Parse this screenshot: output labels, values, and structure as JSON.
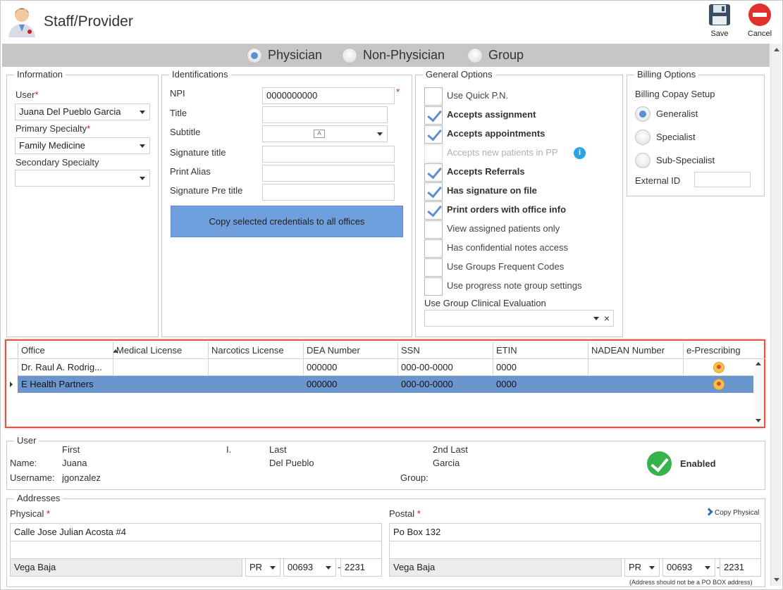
{
  "header": {
    "title": "Staff/Provider",
    "save_label": "Save",
    "cancel_label": "Cancel"
  },
  "provider_types": [
    {
      "label": "Physician",
      "selected": true
    },
    {
      "label": "Non-Physician",
      "selected": false
    },
    {
      "label": "Group",
      "selected": false
    }
  ],
  "information": {
    "legend": "Information",
    "user_label": "User",
    "user_value": "Juana Del Pueblo Garcia",
    "primary_label": "Primary Specialty",
    "primary_value": "Family Medicine",
    "secondary_label": "Secondary Specialty",
    "secondary_value": ""
  },
  "identifications": {
    "legend": "Identifications",
    "npi_label": "NPI",
    "npi_value": "0000000000",
    "title_label": "Title",
    "subtitle_label": "Subtitle",
    "sigtitle_label": "Signature title",
    "alias_label": "Print Alias",
    "sigpre_label": "Signature Pre title",
    "copy_button": "Copy selected credentials to all offices"
  },
  "general_options": {
    "legend": "General Options",
    "items": [
      {
        "label": "Use Quick P.N.",
        "checked": false,
        "bold": false,
        "disabled": false
      },
      {
        "label": "Accepts assignment",
        "checked": true,
        "bold": true,
        "disabled": false
      },
      {
        "label": "Accepts appointments",
        "checked": true,
        "bold": true,
        "disabled": false
      },
      {
        "label": "Accepts new patients in PP",
        "checked": false,
        "bold": false,
        "disabled": true
      },
      {
        "label": "Accepts Referrals",
        "checked": true,
        "bold": true,
        "disabled": false
      },
      {
        "label": "Has signature on file",
        "checked": true,
        "bold": true,
        "disabled": false
      },
      {
        "label": "Print orders with office info",
        "checked": true,
        "bold": true,
        "disabled": false
      },
      {
        "label": "View assigned patients only",
        "checked": false,
        "bold": false,
        "disabled": false
      },
      {
        "label": "Has confidential notes access",
        "checked": false,
        "bold": false,
        "disabled": false
      },
      {
        "label": "Use Groups Frequent Codes",
        "checked": false,
        "bold": false,
        "disabled": false
      },
      {
        "label": "Use progress note group settings",
        "checked": false,
        "bold": false,
        "disabled": false
      }
    ],
    "clinical_eval_label": "Use Group Clinical Evaluation",
    "info_glyph": "i"
  },
  "billing": {
    "legend": "Billing Options",
    "copay_label": "Billing Copay Setup",
    "options": [
      {
        "label": "Generalist",
        "selected": true
      },
      {
        "label": "Specialist",
        "selected": false
      },
      {
        "label": "Sub-Specialist",
        "selected": false
      }
    ],
    "external_label": "External ID",
    "external_value": ""
  },
  "offices_grid": {
    "columns": [
      "Office",
      "Medical License",
      "Narcotics License",
      "DEA Number",
      "SSN",
      "ETIN",
      "NADEAN Number",
      "e-Prescribing"
    ],
    "rows": [
      {
        "office": "Dr. Raul A. Rodrig...",
        "medical": "",
        "narcotics": "",
        "dea": "000000",
        "ssn": "000-00-0000",
        "etin": "0000",
        "nadean": "",
        "eprescribing": "warning-icon"
      },
      {
        "office": "E Health Partners",
        "medical": "",
        "narcotics": "",
        "dea": "000000",
        "ssn": "000-00-0000",
        "etin": "0000",
        "nadean": "",
        "eprescribing": "warning-icon"
      }
    ],
    "selected_row": 1
  },
  "user": {
    "legend": "User",
    "first_label": "First",
    "i_label": "I.",
    "last_label": "Last",
    "second_last_label": "2nd Last",
    "name_label": "Name:",
    "first": "Juana",
    "last": "Del Pueblo",
    "second_last": "Garcia",
    "username_label": "Username:",
    "username": "jgonzalez",
    "group_label": "Group:",
    "status": "Enabled"
  },
  "addresses": {
    "legend": "Addresses",
    "physical_label": "Physical",
    "postal_label": "Postal",
    "copy_physical": "Copy Physical",
    "physical": {
      "line1": "Calle Jose Julian Acosta #4",
      "line2": "",
      "city": "Vega Baja",
      "state": "PR",
      "zip": "00693",
      "zip4": "2231"
    },
    "postal": {
      "line1": "Po Box 132",
      "line2": "",
      "city": "Vega Baja",
      "state": "PR",
      "zip": "00693",
      "zip4": "2231"
    },
    "note": "(Address should not be a PO BOX address)"
  },
  "colors": {
    "accent": "#5b8fd6",
    "selected_row": "#6b95cd",
    "highlight_border": "#e05545",
    "enabled": "#36b34a"
  }
}
